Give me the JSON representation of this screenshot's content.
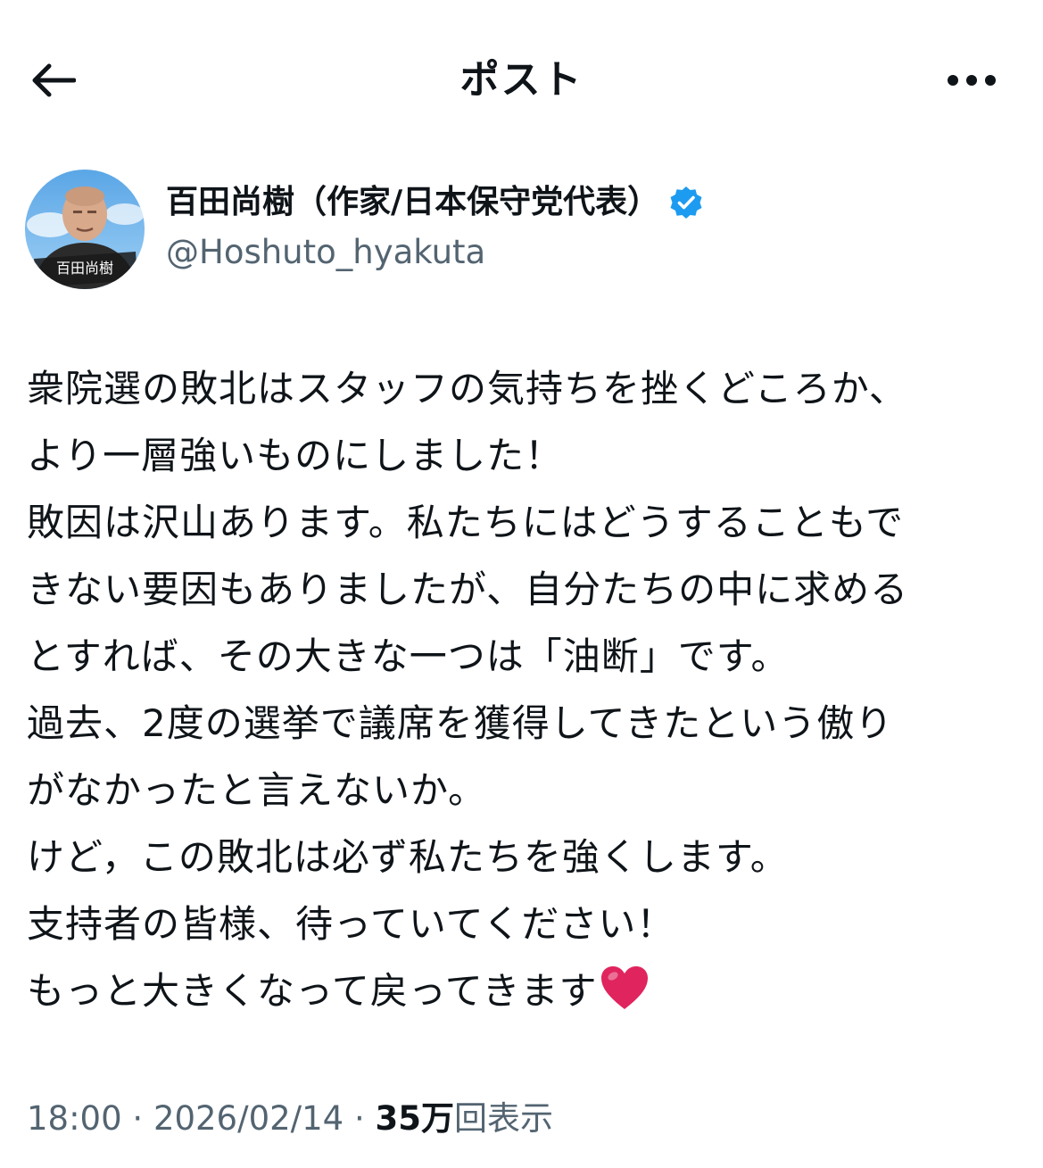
{
  "header": {
    "title": "ポスト",
    "back_icon": "arrow-left-icon",
    "more_icon": "more-horizontal-icon"
  },
  "author": {
    "display_name": "百田尚樹（作家/日本保守党代表）",
    "handle": "@Hoshuto_hyakuta",
    "verified": true,
    "verified_color": "#1d9bf0",
    "avatar_caption": "百田尚樹"
  },
  "tweet": {
    "lines": [
      "衆院選の敗北はスタッフの気持ちを挫くどころか、",
      "より一層強いものにしました！",
      "敗因は沢山あります。私たちにはどうすることもで",
      "きない要因もありましたが、自分たちの中に求める",
      "とすれば、その大きな一つは「油断」です。",
      "過去、2度の選挙で議席を獲得してきたという傲り",
      "がなかったと言えないか。",
      "けど，この敗北は必ず私たちを強くします。",
      "支持者の皆様、待っていてください！",
      "もっと大きくなって戻ってきます"
    ],
    "trailing_emoji": "❤️"
  },
  "meta": {
    "time": "18:00",
    "separator": "·",
    "date": "2026/02/14",
    "views_count": "35万",
    "views_label": "回表示"
  },
  "colors": {
    "text_primary": "#0f1419",
    "text_secondary": "#536471",
    "accent": "#1d9bf0",
    "heart": "#e0245e"
  }
}
